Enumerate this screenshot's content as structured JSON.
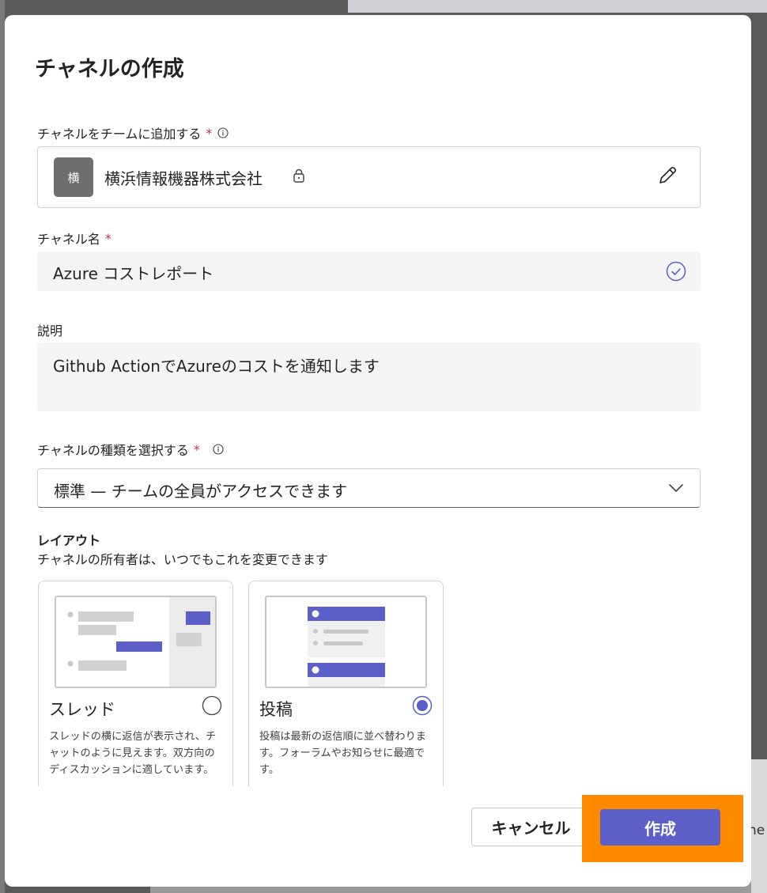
{
  "dialog": {
    "title": "チャネルの作成",
    "team": {
      "label": "チャネルをチームに追加する",
      "required_mark": "*",
      "avatar_text": "横",
      "name": "横浜情報機器株式会社"
    },
    "channel_name": {
      "label": "チャネル名",
      "required_mark": "*",
      "value": "Azure コストレポート"
    },
    "description": {
      "label": "説明",
      "value": "Github ActionでAzureのコストを通知します"
    },
    "channel_type": {
      "label": "チャネルの種類を選択する",
      "required_mark": "*",
      "selected": "標準 — チームの全員がアクセスできます"
    },
    "layout": {
      "title": "レイアウト",
      "subtitle": "チャネルの所有者は、いつでもこれを変更できます",
      "options": [
        {
          "name": "スレッド",
          "description": "スレッドの横に返信が表示され、チャットのように見えます。双方向のディスカッションに適しています。",
          "selected": false
        },
        {
          "name": "投稿",
          "description": "投稿は最新の返信順に並べ替わります。フォーラムやお知らせに最適です。",
          "selected": true
        }
      ]
    },
    "buttons": {
      "cancel": "キャンセル",
      "create": "作成"
    }
  },
  "background": {
    "edge_text": "ne"
  },
  "colors": {
    "accent": "#5b5fc7",
    "highlight": "#ff8a00",
    "required": "#c4314b"
  }
}
